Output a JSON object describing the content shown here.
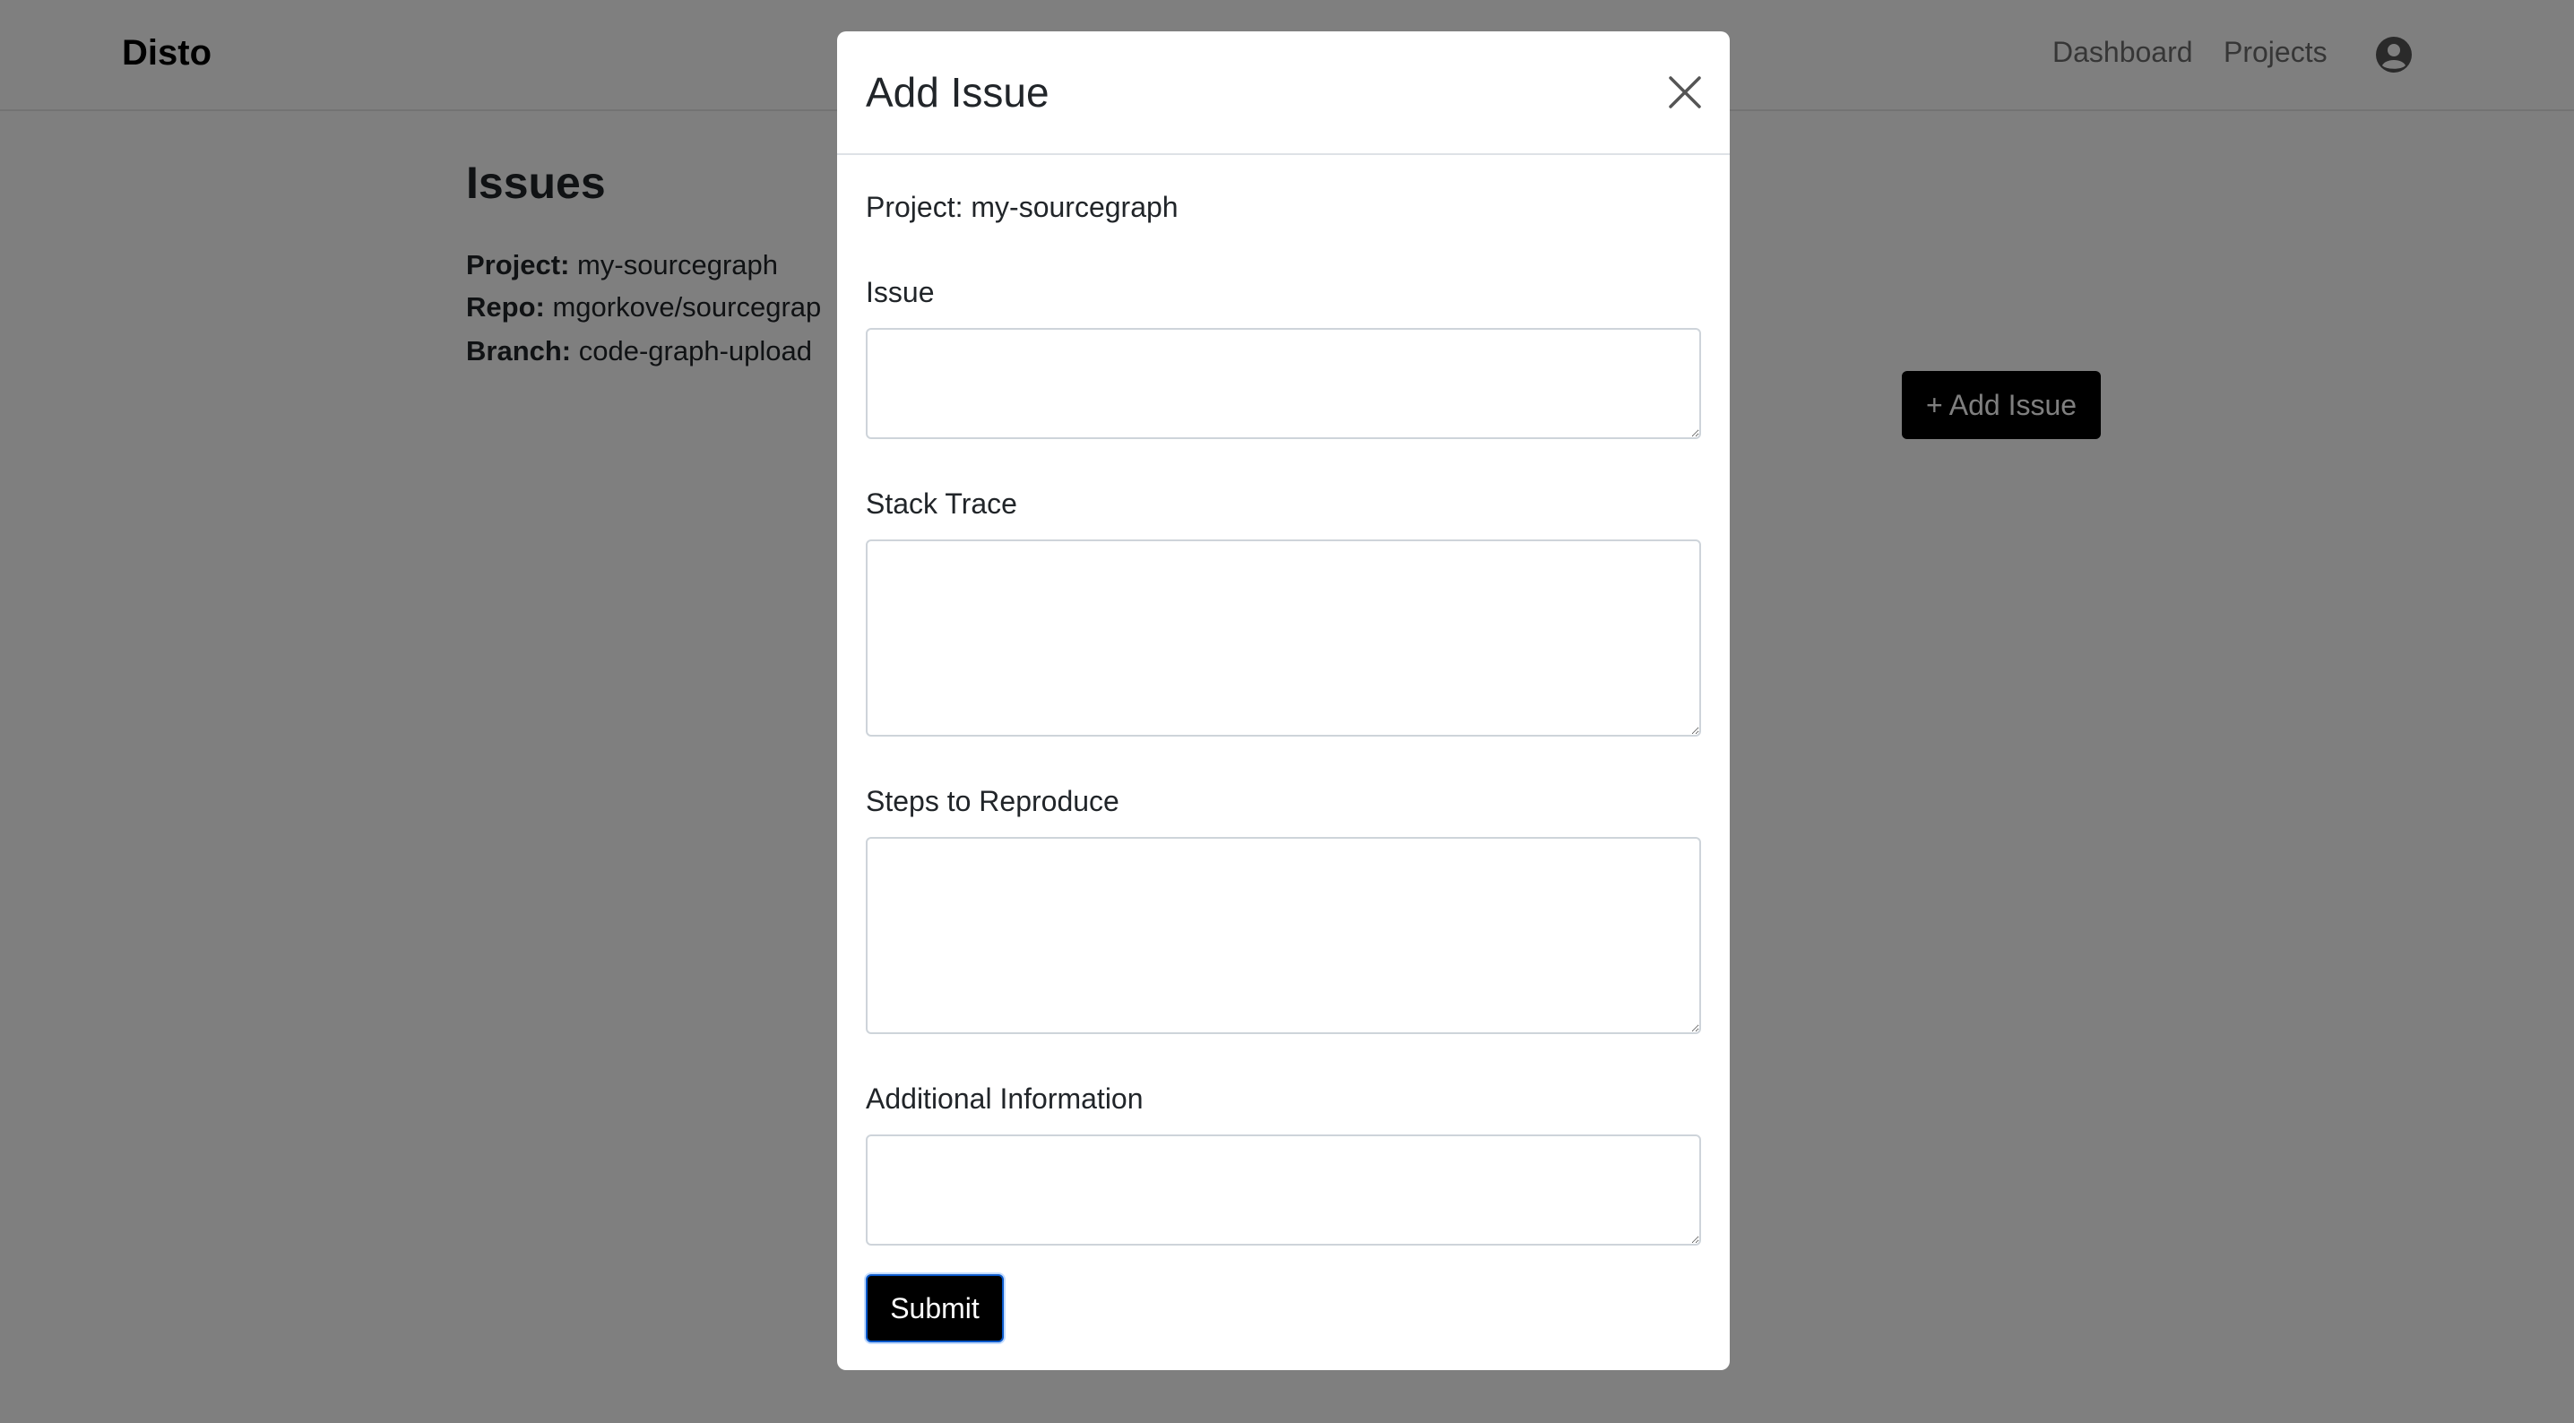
{
  "navbar": {
    "brand": "Disto",
    "links": [
      "Dashboard",
      "Projects"
    ],
    "avatar_icon": "user-circle-icon"
  },
  "page": {
    "title": "Issues",
    "project_label": "Project:",
    "project_value": "my-sourcegraph",
    "repo_label": "Repo:",
    "repo_value": "mgorkove/sourcegrap",
    "branch_label": "Branch:",
    "branch_value": "code-graph-upload",
    "add_button": "+ Add Issue"
  },
  "modal": {
    "title": "Add Issue",
    "close_icon": "close-icon",
    "project_line": "Project: my-sourcegraph",
    "fields": [
      {
        "label": "Issue",
        "value": ""
      },
      {
        "label": "Stack Trace",
        "value": ""
      },
      {
        "label": "Steps to Reproduce",
        "value": ""
      },
      {
        "label": "Additional Information",
        "value": ""
      }
    ],
    "submit_label": "Submit"
  },
  "colors": {
    "backdrop": "#808080",
    "button": "#000000",
    "submit_focus_border": "#0a58ca"
  }
}
